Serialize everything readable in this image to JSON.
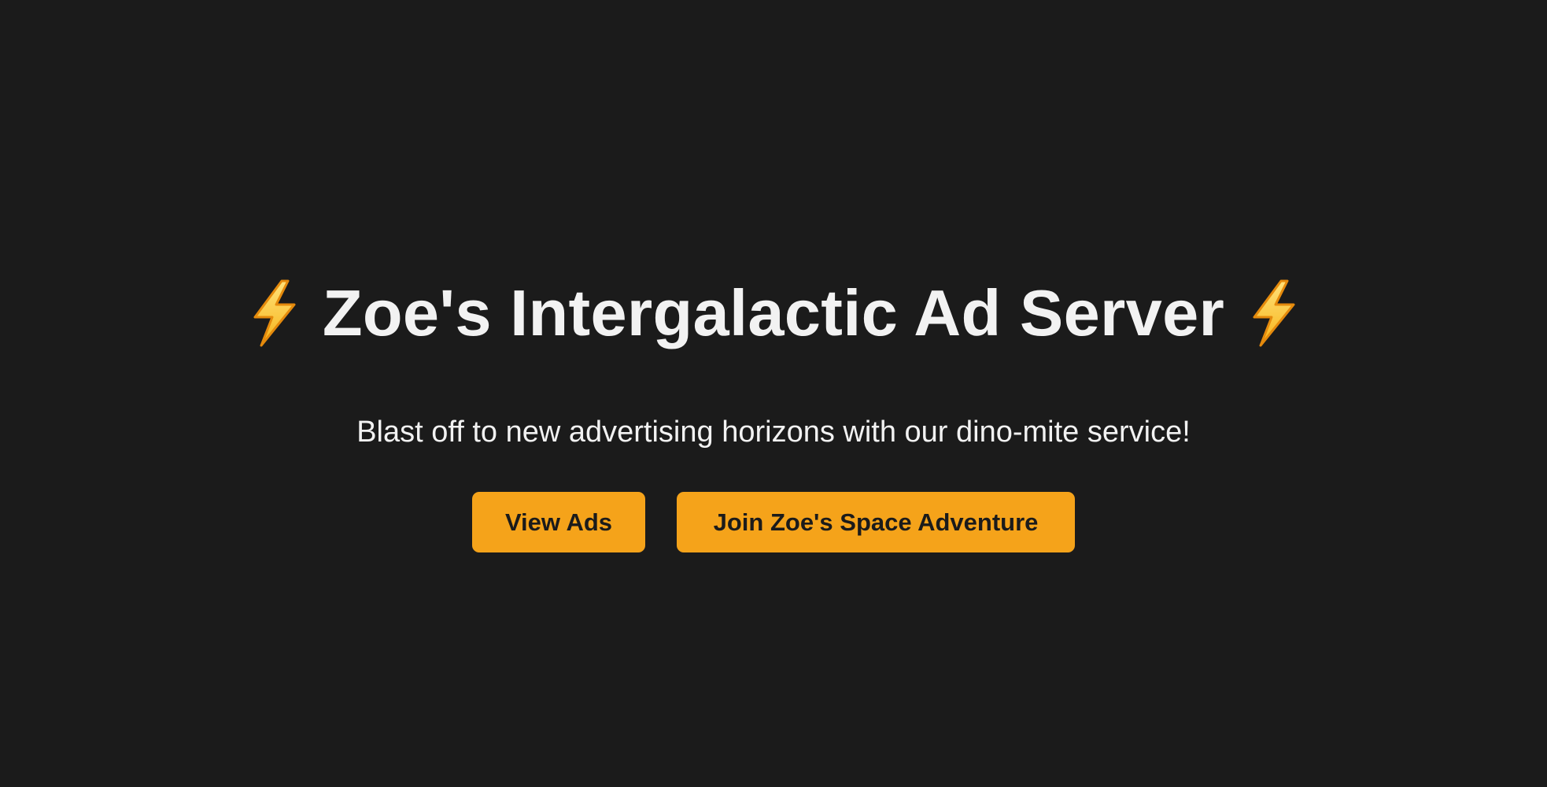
{
  "hero": {
    "title": "Zoe's Intergalactic Ad Server",
    "title_icon": "lightning-bolt-icon",
    "subtitle": "Blast off to new advertising horizons with our dino-mite service!"
  },
  "buttons": {
    "view_ads_label": "View Ads",
    "join_label": "Join Zoe's Space Adventure"
  },
  "colors": {
    "background": "#1b1b1b",
    "text": "#f2f2f2",
    "accent": "#f5a31a",
    "button_text": "#1b1b1b"
  }
}
